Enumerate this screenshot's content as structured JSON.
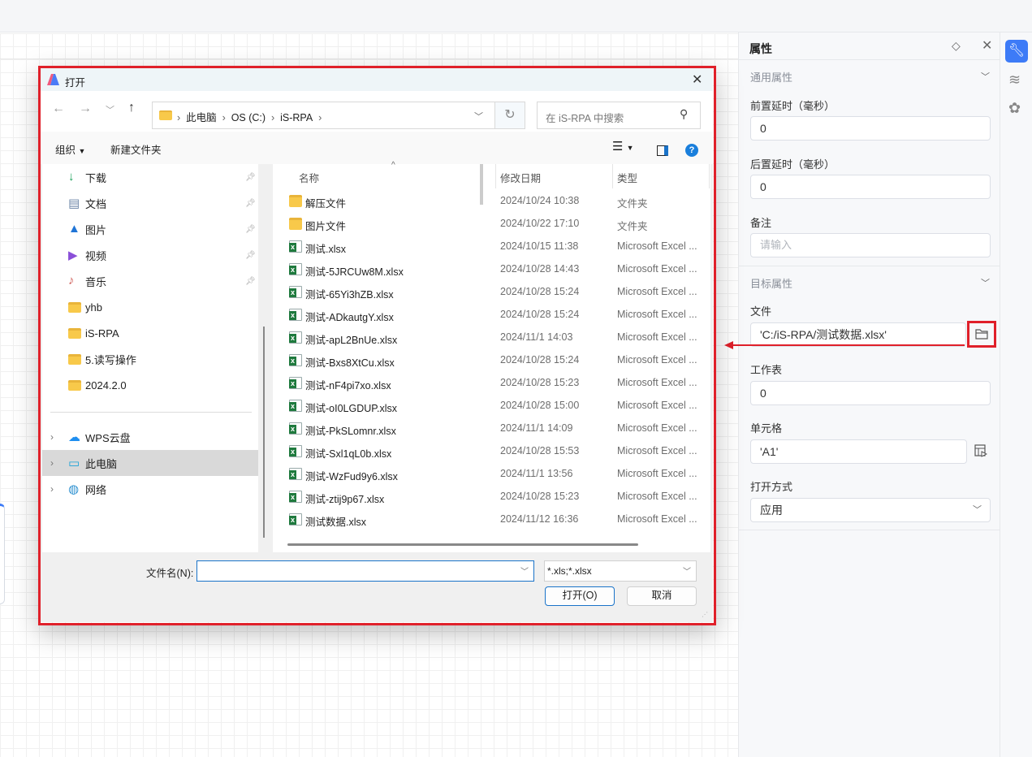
{
  "properties_panel": {
    "title": "属性",
    "general_section": "通用属性",
    "pre_delay_label": "前置延时（毫秒）",
    "pre_delay_value": "0",
    "post_delay_label": "后置延时（毫秒）",
    "post_delay_value": "0",
    "note_label": "备注",
    "note_placeholder": "请输入",
    "target_section": "目标属性",
    "file_label": "文件",
    "file_value": "'C:/iS-RPA/测试数据.xlsx'",
    "sheet_label": "工作表",
    "sheet_value": "0",
    "cell_label": "单元格",
    "cell_value": "'A1'",
    "open_mode_label": "打开方式",
    "open_mode_value": "应用"
  },
  "side_icons": [
    "wrench-icon",
    "layers-icon",
    "openai-icon"
  ],
  "accent_color": "#3d7bf7",
  "highlight_color": "#e0202a",
  "dialog": {
    "title": "打开",
    "breadcrumb": [
      "此电脑",
      "OS (C:)",
      "iS-RPA"
    ],
    "search_placeholder": "在 iS-RPA 中搜索",
    "organize": "组织",
    "new_folder": "新建文件夹",
    "nav": [
      {
        "label": "下载",
        "icon": "download-icon",
        "pinned": true
      },
      {
        "label": "文档",
        "icon": "document-icon",
        "pinned": true
      },
      {
        "label": "图片",
        "icon": "pictures-icon",
        "pinned": true
      },
      {
        "label": "视频",
        "icon": "video-icon",
        "pinned": true
      },
      {
        "label": "音乐",
        "icon": "music-icon",
        "pinned": true
      },
      {
        "label": "yhb",
        "icon": "folder-icon"
      },
      {
        "label": "iS-RPA",
        "icon": "folder-icon"
      },
      {
        "label": "5.读写操作",
        "icon": "folder-error-icon"
      },
      {
        "label": "2024.2.0",
        "icon": "folder-synced-icon"
      }
    ],
    "nav_roots": [
      {
        "label": "WPS云盘",
        "icon": "cloud-icon"
      },
      {
        "label": "此电脑",
        "icon": "computer-icon",
        "selected": true
      },
      {
        "label": "网络",
        "icon": "network-icon"
      }
    ],
    "columns": [
      "名称",
      "修改日期",
      "类型"
    ],
    "files": [
      {
        "name": "解压文件",
        "date": "2024/10/24 10:38",
        "type": "文件夹",
        "kind": "folder"
      },
      {
        "name": "图片文件",
        "date": "2024/10/22 17:10",
        "type": "文件夹",
        "kind": "folder"
      },
      {
        "name": "测试.xlsx",
        "date": "2024/10/15 11:38",
        "type": "Microsoft Excel ...",
        "kind": "excel"
      },
      {
        "name": "测试-5JRCUw8M.xlsx",
        "date": "2024/10/28 14:43",
        "type": "Microsoft Excel ...",
        "kind": "excel"
      },
      {
        "name": "测试-65Yi3hZB.xlsx",
        "date": "2024/10/28 15:24",
        "type": "Microsoft Excel ...",
        "kind": "excel"
      },
      {
        "name": "测试-ADkautgY.xlsx",
        "date": "2024/10/28 15:24",
        "type": "Microsoft Excel ...",
        "kind": "excel"
      },
      {
        "name": "测试-apL2BnUe.xlsx",
        "date": "2024/11/1 14:03",
        "type": "Microsoft Excel ...",
        "kind": "excel"
      },
      {
        "name": "测试-Bxs8XtCu.xlsx",
        "date": "2024/10/28 15:24",
        "type": "Microsoft Excel ...",
        "kind": "excel"
      },
      {
        "name": "测试-nF4pi7xo.xlsx",
        "date": "2024/10/28 15:23",
        "type": "Microsoft Excel ...",
        "kind": "excel"
      },
      {
        "name": "测试-oI0LGDUP.xlsx",
        "date": "2024/10/28 15:00",
        "type": "Microsoft Excel ...",
        "kind": "excel"
      },
      {
        "name": "测试-PkSLomnr.xlsx",
        "date": "2024/11/1 14:09",
        "type": "Microsoft Excel ...",
        "kind": "excel"
      },
      {
        "name": "测试-Sxl1qL0b.xlsx",
        "date": "2024/10/28 15:53",
        "type": "Microsoft Excel ...",
        "kind": "excel"
      },
      {
        "name": "测试-WzFud9y6.xlsx",
        "date": "2024/11/1 13:56",
        "type": "Microsoft Excel ...",
        "kind": "excel"
      },
      {
        "name": "测试-ztij9p67.xlsx",
        "date": "2024/10/28 15:23",
        "type": "Microsoft Excel ...",
        "kind": "excel"
      },
      {
        "name": "测试数据.xlsx",
        "date": "2024/11/12 16:36",
        "type": "Microsoft Excel ...",
        "kind": "excel"
      }
    ],
    "filename_label": "文件名(N):",
    "filename_value": "",
    "filter_value": "*.xls;*.xlsx",
    "open_button": "打开(O)",
    "cancel_button": "取消"
  }
}
